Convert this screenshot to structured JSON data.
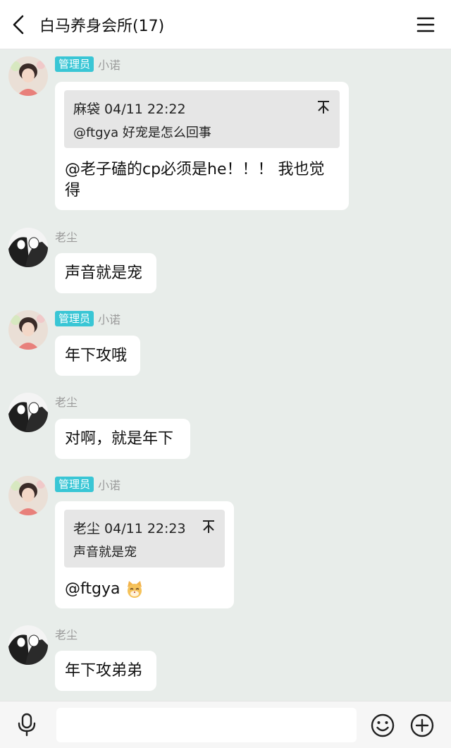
{
  "header": {
    "title": "白马养身会所(17)"
  },
  "messages": [
    {
      "badge": "管理员",
      "sender": "小诺",
      "quote_meta": "麻袋 04/11 22:22",
      "quote_text": "@ftgya 好宠是怎么回事",
      "text_line1": "@老子磕的cp必须是he！！！ 我也觉",
      "text_line2": "得"
    },
    {
      "sender": "老尘",
      "text": "声音就是宠"
    },
    {
      "badge": "管理员",
      "sender": "小诺",
      "text": "年下攻哦"
    },
    {
      "sender": "老尘",
      "text": "对啊，就是年下"
    },
    {
      "badge": "管理员",
      "sender": "小诺",
      "quote_meta": "老尘 04/11 22:23",
      "quote_text": "声音就是宠",
      "text": "@ftgya"
    },
    {
      "sender": "老尘",
      "text": "年下攻弟弟"
    }
  ],
  "input": {
    "value": "",
    "placeholder": ""
  },
  "icons": {
    "back": "back-arrow-icon",
    "menu": "hamburger-menu-icon",
    "pin": "pin-top-icon",
    "mic": "microphone-icon",
    "emoji": "smiley-face-icon",
    "plus": "plus-circle-icon",
    "cat_emoji": "cat-face-emoji-icon"
  },
  "colors": {
    "background": "#e8edea",
    "badge": "#39c6d5",
    "bubble": "#ffffff",
    "quote": "#e6e6e6"
  }
}
